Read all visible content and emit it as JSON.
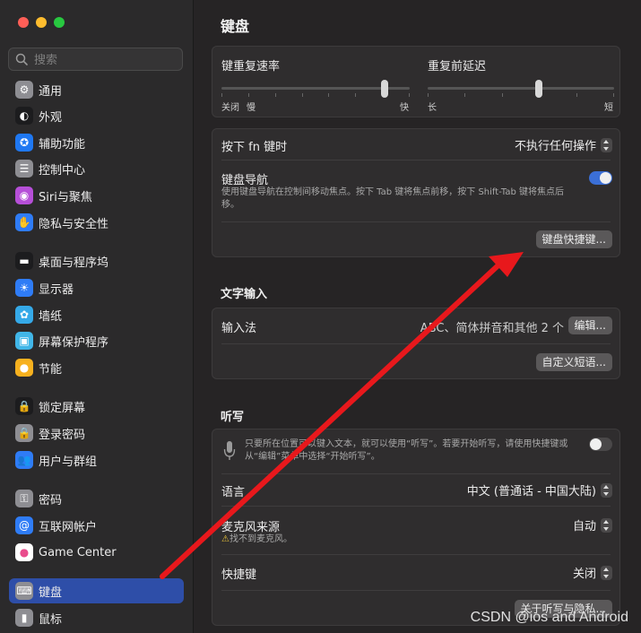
{
  "window": {
    "traffic_colors": [
      "#ff5f57",
      "#febc2e",
      "#28c840"
    ]
  },
  "search": {
    "placeholder": "搜索"
  },
  "sidebar": {
    "items": [
      {
        "label": "通用",
        "icon": "gear-icon",
        "color": "#8e8e93"
      },
      {
        "label": "外观",
        "icon": "appearance-icon",
        "color": "#1c1c1e"
      },
      {
        "label": "辅助功能",
        "icon": "accessibility-icon",
        "color": "#1f78f2"
      },
      {
        "label": "控制中心",
        "icon": "control-center-icon",
        "color": "#8e8e93"
      },
      {
        "label": "Siri与聚焦",
        "icon": "siri-icon",
        "color": "#b64fd8"
      },
      {
        "label": "隐私与安全性",
        "icon": "hand-icon",
        "color": "#2f7cf6"
      },
      {
        "label": "桌面与程序坞",
        "icon": "dock-icon",
        "color": "#1c1c1e"
      },
      {
        "label": "显示器",
        "icon": "sun-icon",
        "color": "#2f7cf6"
      },
      {
        "label": "墙纸",
        "icon": "flower-icon",
        "color": "#35a9e8"
      },
      {
        "label": "屏幕保护程序",
        "icon": "screensaver-icon",
        "color": "#41b6e8"
      },
      {
        "label": "节能",
        "icon": "bulb-icon",
        "color": "#f7b11f"
      },
      {
        "label": "锁定屏幕",
        "icon": "lock-screen-icon",
        "color": "#1c1c1e"
      },
      {
        "label": "登录密码",
        "icon": "padlock-icon",
        "color": "#8e8e93"
      },
      {
        "label": "用户与群组",
        "icon": "users-icon",
        "color": "#2f7cf6"
      },
      {
        "label": "密码",
        "icon": "key-icon",
        "color": "#8e8e93"
      },
      {
        "label": "互联网帐户",
        "icon": "at-icon",
        "color": "#2f7cf6"
      },
      {
        "label": "Game Center",
        "icon": "game-center-icon",
        "color": "#ffffff"
      },
      {
        "label": "键盘",
        "icon": "keyboard-icon",
        "color": "#8e8e93"
      },
      {
        "label": "鼠标",
        "icon": "mouse-icon",
        "color": "#8e8e93"
      }
    ],
    "selected_index": 17
  },
  "main": {
    "title": "键盘",
    "repeat_rate": {
      "label": "键重复速率",
      "left": "关闭",
      "mid": "慢",
      "right": "快",
      "value": 0.88
    },
    "repeat_delay": {
      "label": "重复前延迟",
      "left": "长",
      "right": "短",
      "value": 0.6
    },
    "fn_key": {
      "label": "按下 fn 键时",
      "value": "不执行任何操作"
    },
    "keyboard_nav": {
      "label": "键盘导航",
      "desc": "使用键盘导航在控制间移动焦点。按下 Tab 键将焦点前移，按下 Shift-Tab 键将焦点后移。",
      "on": true
    },
    "shortcuts_button": "键盘快捷键...",
    "text_input": {
      "section": "文字输入",
      "input_source_label": "输入法",
      "input_source_value": "ABC、简体拼音和其他 2 个",
      "edit_button": "编辑...",
      "phrases_button": "自定义短语..."
    },
    "dictation": {
      "section": "听写",
      "desc": "只要所在位置可以键入文本，就可以使用“听写”。若要开始听写，请使用快捷键或从“编辑”菜单中选择“开始听写”。",
      "on": false,
      "language_label": "语言",
      "language_value": "中文 (普通话 - 中国大陆)",
      "mic_label": "麦克风来源",
      "mic_value": "自动",
      "mic_warning": "找不到麦克风。",
      "shortcut_label": "快捷键",
      "shortcut_value": "关闭",
      "privacy_button": "关于听写与隐私..."
    }
  },
  "colors": {
    "accent": "#2e4ea8",
    "toggle_on": "#3b6fd6",
    "annotation_arrow": "#e8181c"
  },
  "watermark": "CSDN @ios and Android"
}
